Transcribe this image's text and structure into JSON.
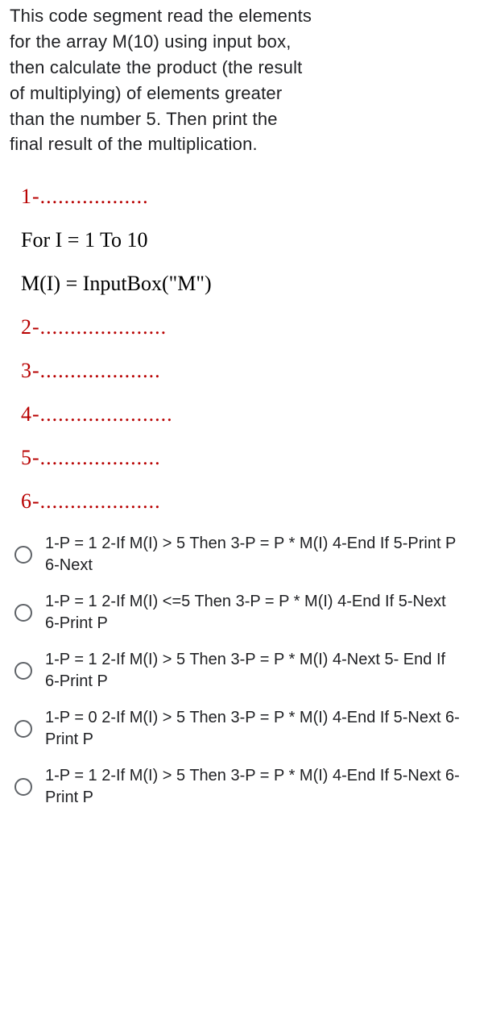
{
  "question": {
    "intro_lines": [
      "This code segment read the elements",
      "for the array M(10) using input box,",
      "then calculate the product (the result",
      "of multiplying)  of elements greater",
      "than the number  5. Then print the",
      "final result of the multiplication."
    ],
    "blank1": "1-..................",
    "code_line1": "For I = 1 To 10",
    "code_line2": "M(I) = InputBox(\"M\")",
    "blank2": "2-.....................",
    "blank3": "3-....................",
    "blank4": "4-......................",
    "blank5": "5-....................",
    "blank6": "6-...................."
  },
  "options": [
    {
      "text": "1-P = 1 2-If M(I) > 5 Then 3-P = P * M(I) 4-End If 5-Print P 6-Next"
    },
    {
      "text": "1-P = 1 2-If M(I) <=5 Then 3-P = P * M(I) 4-End If 5-Next 6-Print P"
    },
    {
      "text": "1-P = 1 2-If M(I) > 5 Then 3-P = P * M(I) 4-Next 5- End If 6-Print P"
    },
    {
      "text": "1-P = 0 2-If M(I) > 5 Then 3-P = P * M(I) 4-End If 5-Next 6-Print P"
    },
    {
      "text": "1-P = 1 2-If M(I) > 5 Then 3-P = P * M(I) 4-End If 5-Next 6-Print P"
    }
  ]
}
